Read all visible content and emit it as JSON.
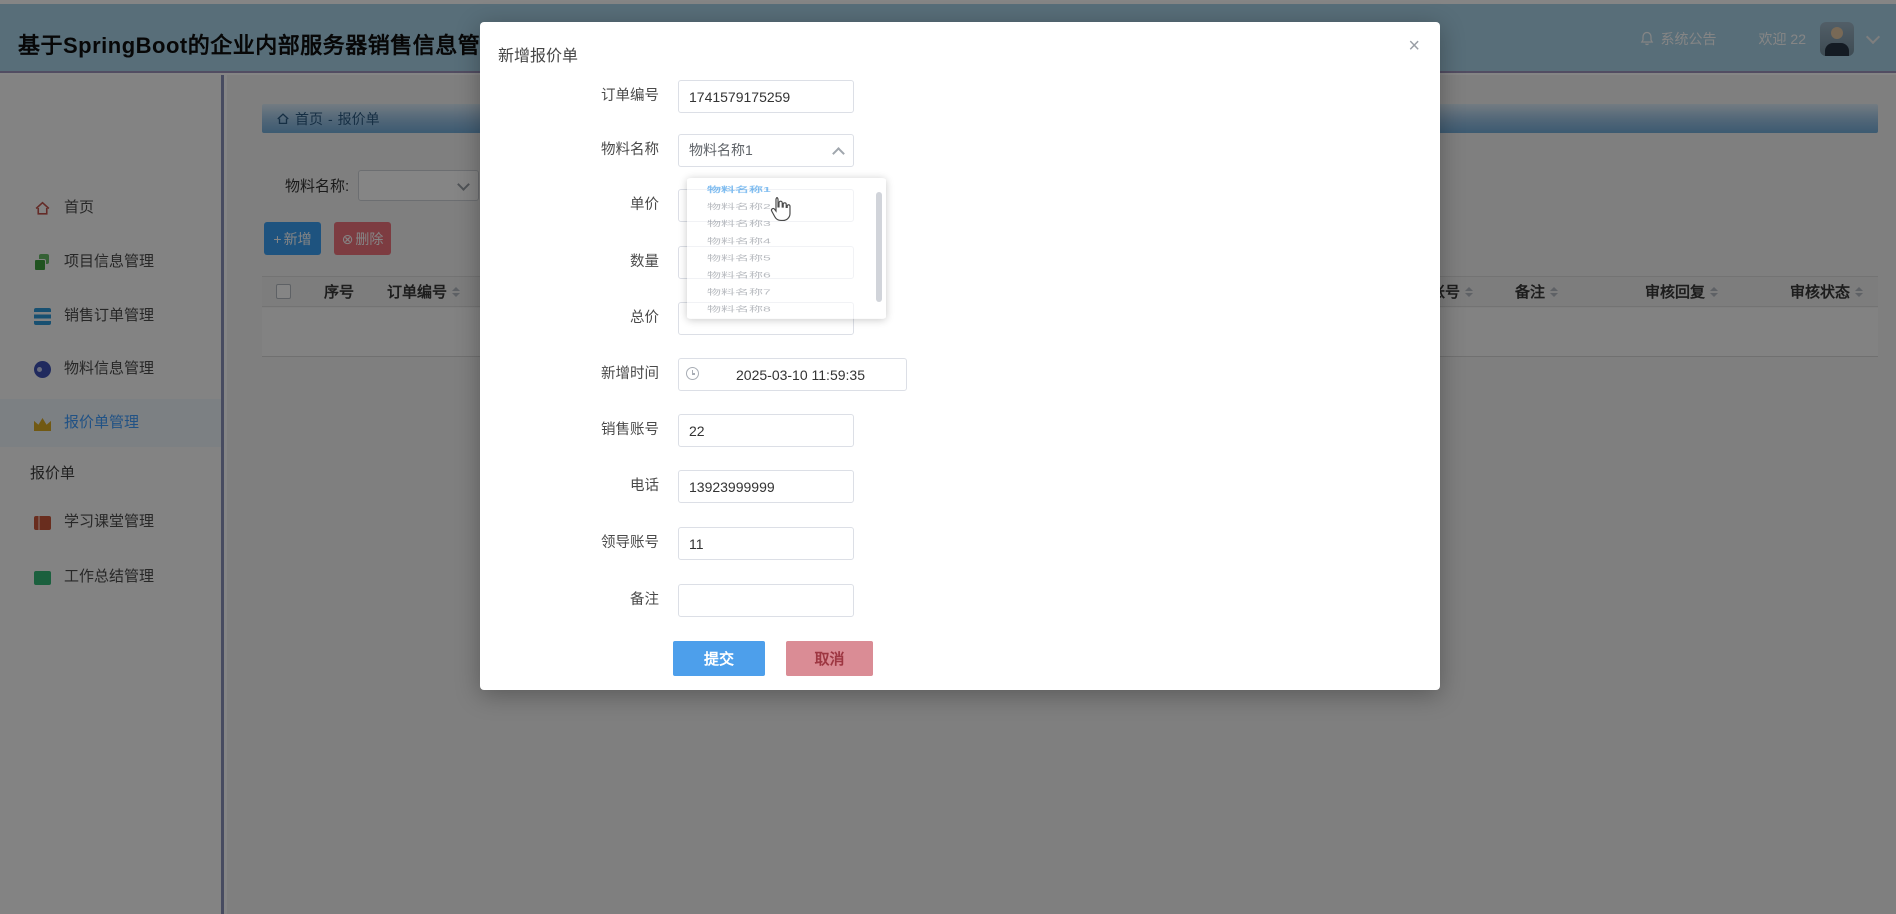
{
  "header": {
    "title": "基于SpringBoot的企业内部服务器销售信息管理",
    "announcement": "系统公告",
    "welcome": "欢迎 22"
  },
  "sidebar": {
    "items": [
      {
        "label": "首页",
        "selected": false
      },
      {
        "label": "项目信息管理",
        "selected": false
      },
      {
        "label": "销售订单管理",
        "selected": false
      },
      {
        "label": "物料信息管理",
        "selected": false
      },
      {
        "label": "报价单管理",
        "selected": true
      },
      {
        "label": "学习课堂管理",
        "selected": false
      },
      {
        "label": "工作总结管理",
        "selected": false
      }
    ],
    "sub_label": "报价单"
  },
  "breadcrumb": {
    "home": "首页",
    "separator": "-",
    "current": "报价单"
  },
  "filter": {
    "label": "物料名称:"
  },
  "toolbar": {
    "add": "新增",
    "delete": "删除"
  },
  "icons": {
    "add": "+",
    "delete": "⊗",
    "close": "×"
  },
  "table": {
    "headers": [
      "序号",
      "订单编号",
      "领导账号",
      "备注",
      "审核回复",
      "审核状态"
    ]
  },
  "modal": {
    "title": "新增报价单",
    "fields": [
      {
        "label": "订单编号",
        "value": "1741579175259"
      },
      {
        "label": "物料名称",
        "value": "物料名称1"
      },
      {
        "label": "单价",
        "value": ""
      },
      {
        "label": "数量",
        "value": ""
      },
      {
        "label": "总价",
        "value": ""
      },
      {
        "label": "新增时间",
        "value": "2025-03-10 11:59:35"
      },
      {
        "label": "销售账号",
        "value": "22"
      },
      {
        "label": "电话",
        "value": "13923999999"
      },
      {
        "label": "领导账号",
        "value": "11"
      },
      {
        "label": "备注",
        "value": ""
      }
    ],
    "submit": "提交",
    "cancel": "取消"
  },
  "dropdown": {
    "options": [
      "物料名称1",
      "物料名称2",
      "物料名称3",
      "物料名称4",
      "物料名称5",
      "物料名称6",
      "物料名称7",
      "物料名称8"
    ],
    "selected_index": 0
  },
  "colors": {
    "header_bg": "#a9d3e8",
    "accent_blue": "#409EFF",
    "danger_red": "#ef737e",
    "cancel_pink": "#da8c95",
    "gold": "#d9ab25",
    "backdrop": "rgba(0,0,0,0.48)"
  }
}
